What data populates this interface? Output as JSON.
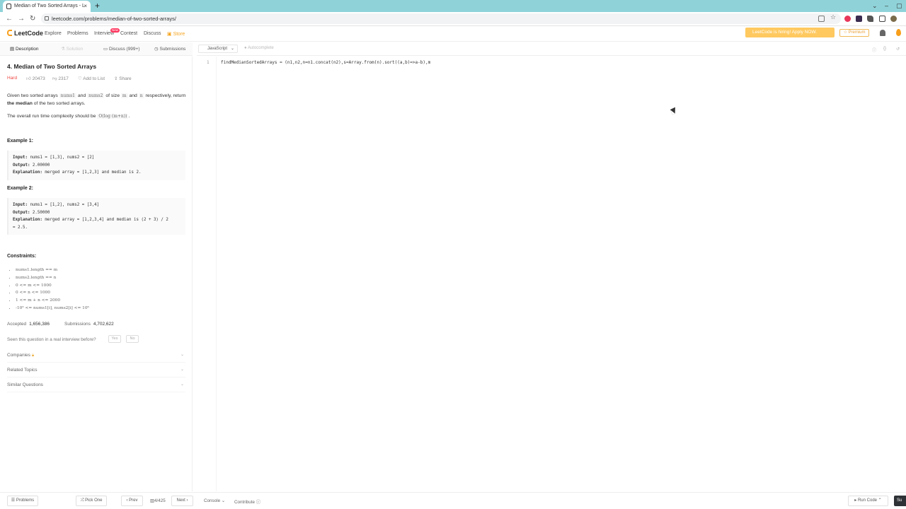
{
  "browser": {
    "tab_title": "Median of Two Sorted Arrays - L",
    "tab_close": "×",
    "new_tab": "+",
    "url": "leetcode.com/problems/median-of-two-sorted-arrays/",
    "controls": {
      "minimize": "–",
      "maximize": "▢",
      "close": "✕",
      "menu": "⌄"
    }
  },
  "navbar": {
    "brand": "LeetCode",
    "links": [
      "Explore",
      "Problems",
      "Interview",
      "Contest",
      "Discuss",
      "Store"
    ],
    "new_badge": "New",
    "hiring_banner": "LeetCode is hiring! Apply NOW.",
    "premium": "Premium"
  },
  "left_tabs": [
    "Description",
    "Solution",
    "Discuss (999+)",
    "Submissions"
  ],
  "problem": {
    "title": "4. Median of Two Sorted Arrays",
    "difficulty": "Hard",
    "likes": "20473",
    "dislikes": "2317",
    "add_to_list": "Add to List",
    "share": "Share",
    "desc": {
      "t1": "Given two sorted arrays ",
      "c1": "nums1",
      "t2": " and ",
      "c2": "nums2",
      "t3": " of size ",
      "c3": "m",
      "t4": " and ",
      "c4": "n",
      "t5": " respectively, return ",
      "b1": "the median",
      "t6": " of the two sorted arrays."
    },
    "complexity": {
      "t1": "The overall run time complexity should be ",
      "c1": "O(log (m+n))",
      "t2": "."
    },
    "example1": {
      "heading": "Example 1:",
      "input_label": "Input:",
      "input": " nums1 = [1,3], nums2 = [2]",
      "output_label": "Output:",
      "output": " 2.00000",
      "expl_label": "Explanation:",
      "expl": " merged array = [1,2,3] and median is 2."
    },
    "example2": {
      "heading": "Example 2:",
      "input_label": "Input:",
      "input": " nums1 = [1,2], nums2 = [3,4]",
      "output_label": "Output:",
      "output": " 2.50000",
      "expl_label": "Explanation:",
      "expl": " merged array = [1,2,3,4] and median is (2 + 3) / 2",
      "expl2": "= 2.5."
    },
    "constraints_heading": "Constraints:",
    "constraints": [
      "nums1.length == m",
      "nums2.length == n",
      "0 <= m <= 1000",
      "0 <= n <= 1000",
      "1 <= m + n <= 2000",
      "-10⁶ <= nums1[i], nums2[i] <= 10⁶"
    ],
    "accepted_label": "Accepted",
    "accepted": "1,656,386",
    "submissions_label": "Submissions",
    "submissions": "4,702,622",
    "seen_question": "Seen this question in a real interview before?",
    "yes": "Yes",
    "no": "No",
    "companies": "Companies",
    "related_topics": "Related Topics",
    "similar_questions": "Similar Questions"
  },
  "editor": {
    "language": "JavaScript",
    "autocomplete": "Autocomplete",
    "line_number": "1",
    "code": "findMedianSortedArrays = (n1,n2,n=n1.concat(n2),s=Array.from(n).sort((a,b)=>a-b),m"
  },
  "bottom": {
    "problems": "Problems",
    "pick_one": "Pick One",
    "prev": "Prev",
    "page": "4/425",
    "next": "Next",
    "console": "Console",
    "contribute": "Contribute",
    "run_code": "Run Code",
    "submit": "Su"
  },
  "colors": {
    "brand": "#f89f1b",
    "hard": "#ef4743",
    "hiring": "#ffc95f",
    "tab_strip": "#8fd3d9"
  }
}
